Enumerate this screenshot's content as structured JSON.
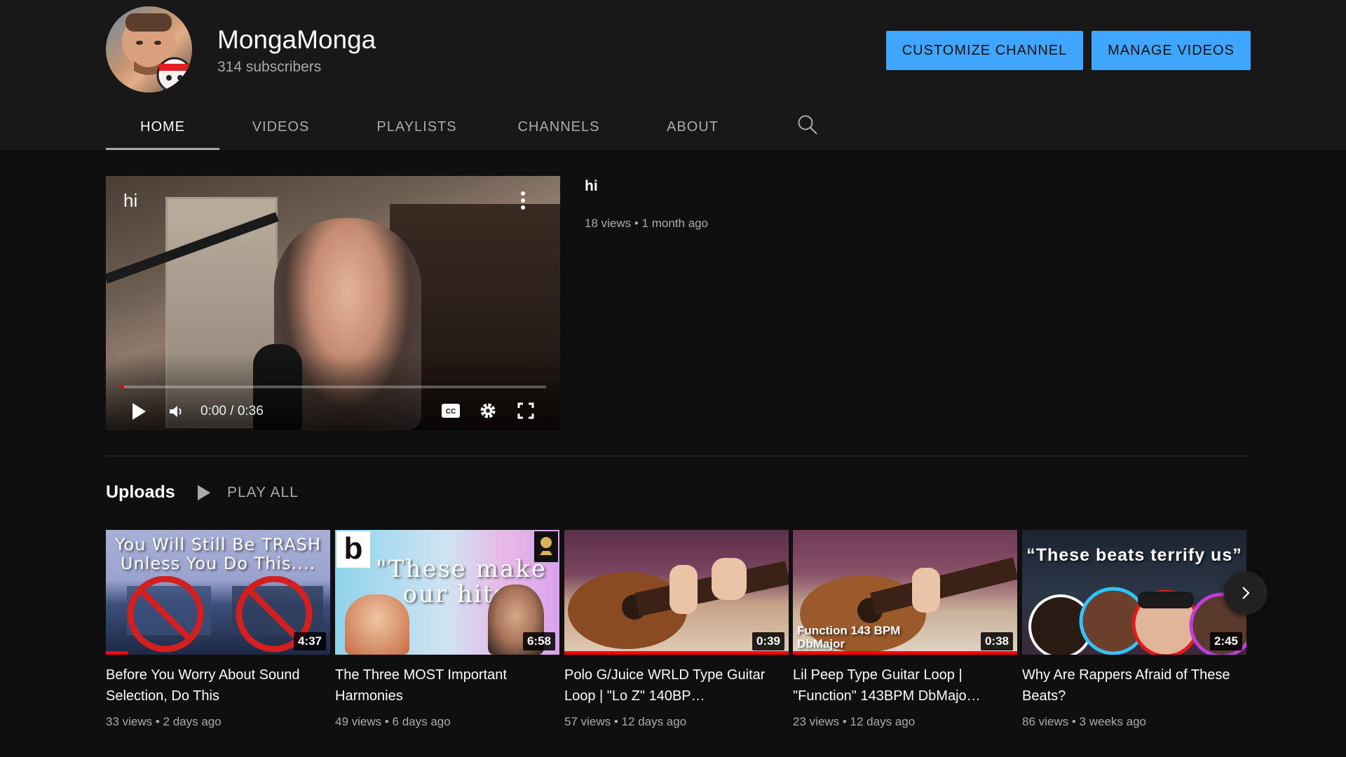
{
  "channel": {
    "name": "MongaMonga",
    "subscribers": "314 subscribers",
    "customize_label": "CUSTOMIZE CHANNEL",
    "manage_label": "MANAGE VIDEOS"
  },
  "tabs": [
    {
      "label": "HOME",
      "active": true
    },
    {
      "label": "VIDEOS",
      "active": false
    },
    {
      "label": "PLAYLISTS",
      "active": false
    },
    {
      "label": "CHANNELS",
      "active": false
    },
    {
      "label": "ABOUT",
      "active": false
    }
  ],
  "featured": {
    "overlay_title": "hi",
    "title": "hi",
    "meta": "18 views • 1 month ago",
    "time": "0:00 / 0:36",
    "progress": 0.01
  },
  "uploads": {
    "title": "Uploads",
    "play_all": "PLAY ALL",
    "videos": [
      {
        "thumb_text": "You Will Still Be TRASH Unless You Do This....",
        "duration": "4:37",
        "watched": 0.1,
        "title": "Before You Worry About Sound Selection, Do This",
        "meta": "33 views • 2 days ago"
      },
      {
        "thumb_text": "\"These make our hits\"",
        "logo": "b",
        "duration": "6:58",
        "watched": 0,
        "title": "The Three MOST Important Harmonies",
        "meta": "49 views • 6 days ago"
      },
      {
        "thumb_text": "",
        "duration": "0:39",
        "watched": 1.0,
        "title": "Polo G/Juice WRLD Type Guitar Loop | \"Lo Z\" 140BP…",
        "meta": "57 views • 12 days ago"
      },
      {
        "thumb_text": "Function 143 BPM DbMajor",
        "duration": "0:38",
        "watched": 1.0,
        "title": "Lil Peep Type Guitar Loop | \"Function\" 143BPM DbMajo…",
        "meta": "23 views • 12 days ago"
      },
      {
        "thumb_text": "“These beats terrify us”",
        "duration": "2:45",
        "watched": 0,
        "title": "Why Are Rappers Afraid of These Beats?",
        "meta": "86 views • 3 weeks ago"
      }
    ]
  },
  "colors": {
    "accent": "#3ea6ff",
    "progress": "#ff0000",
    "background": "#0f0f0f",
    "header": "#181818"
  }
}
